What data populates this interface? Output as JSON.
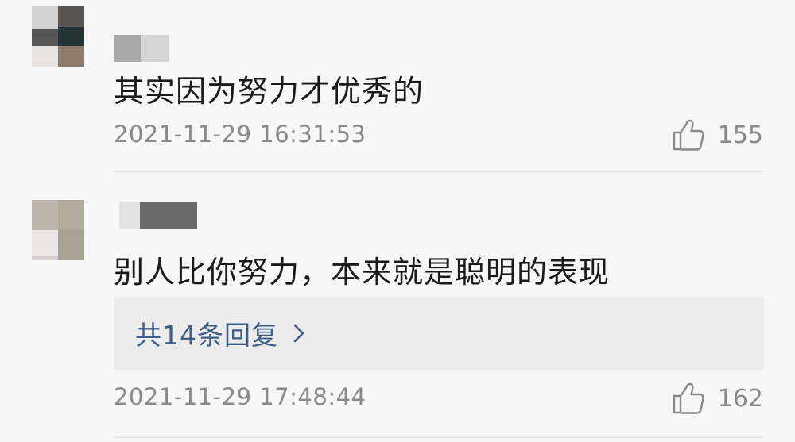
{
  "comments": [
    {
      "text": "其实因为努力才优秀的",
      "timestamp": "2021-11-29 16:31:53",
      "likes": "155",
      "like_icon": "thumbs-up-icon"
    },
    {
      "text": "别人比你努力，本来就是聪明的表现",
      "timestamp": "2021-11-29 17:48:44",
      "likes": "162",
      "like_icon": "thumbs-up-icon",
      "replies_label": "共14条回复",
      "replies_icon": "chevron-right-icon"
    }
  ],
  "colors": {
    "background": "#f7f7f7",
    "text": "#1a1a1a",
    "meta": "#8a8a8a",
    "link": "#3d5f86",
    "reply_box": "#ececec"
  }
}
